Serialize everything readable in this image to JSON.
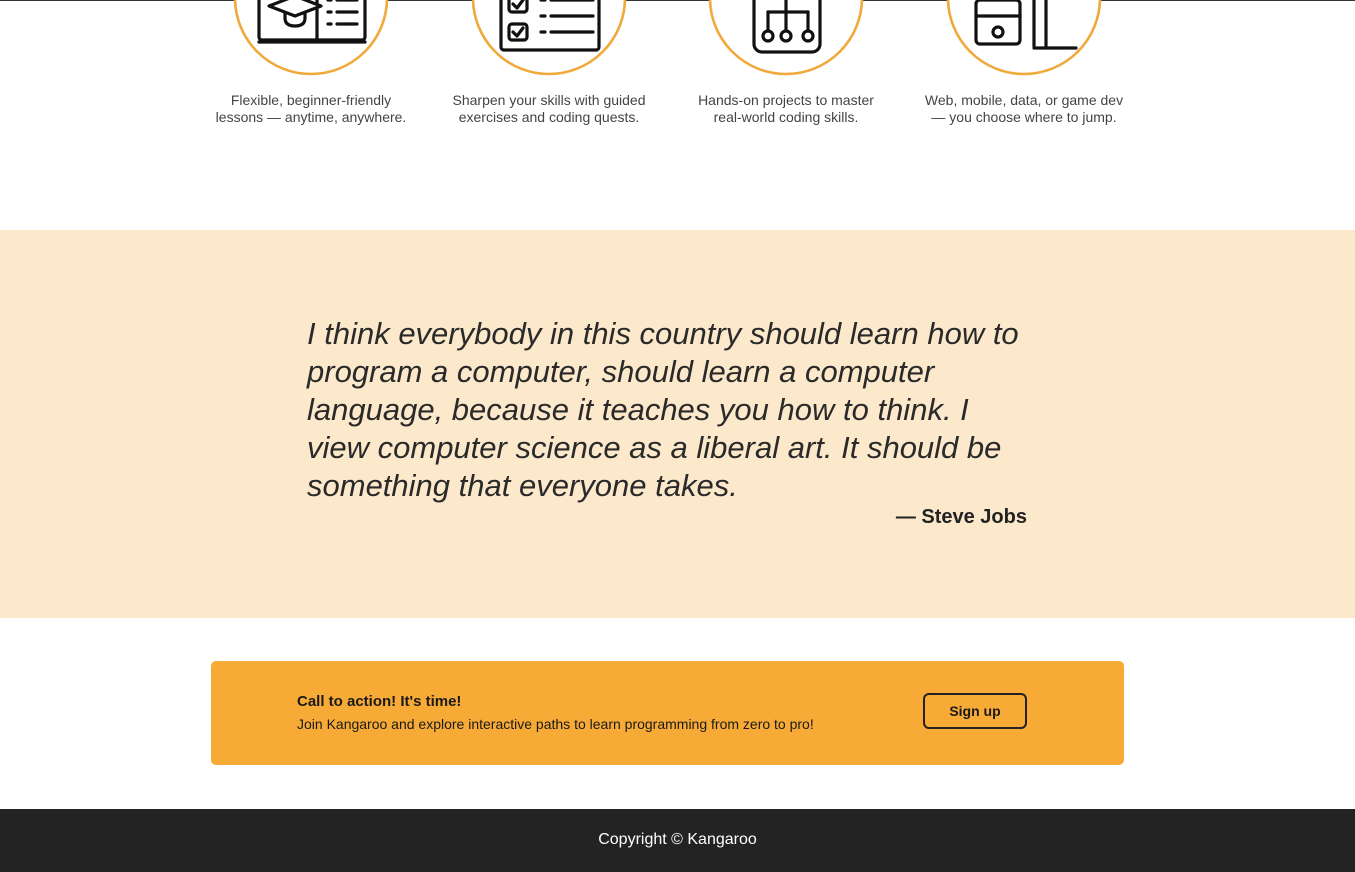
{
  "features": [
    {
      "icon": "online-course-icon",
      "text": "Flexible, beginner-friendly lessons — anytime, anywhere."
    },
    {
      "icon": "checklist-icon",
      "text": "Sharpen your skills with guided exercises and coding quests."
    },
    {
      "icon": "project-diagram-icon",
      "text": "Hands-on projects to master real-world coding skills."
    },
    {
      "icon": "briefcase-desk-icon",
      "text": "Web, mobile, data, or game dev — you choose where to jump."
    }
  ],
  "quote": {
    "text": "I think everybody in this country should learn how to program a computer, should learn a computer language, because it teaches you how to think. I view computer science as a liberal art. It should be something that everyone takes.",
    "author": "— Steve Jobs"
  },
  "cta": {
    "title": "Call to action! It's time!",
    "subtitle": "Join Kangaroo and explore interactive paths to learn programming from zero to pro!",
    "button_label": "Sign up"
  },
  "footer": {
    "copyright": "Copyright © Kangaroo"
  },
  "colors": {
    "accent": "#f7aa36",
    "circle_border": "#f0a93b",
    "quote_bg": "#fce8cb",
    "footer_bg": "#232323"
  }
}
